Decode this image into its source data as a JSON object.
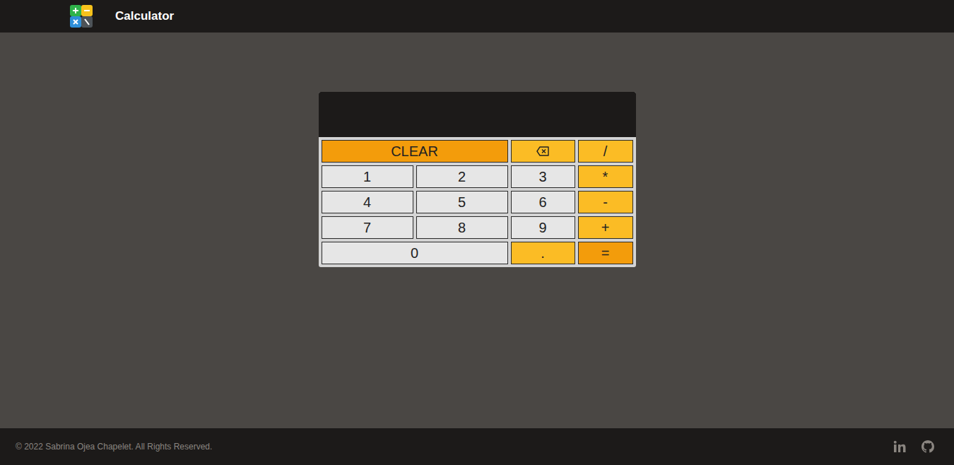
{
  "header": {
    "title": "Calculator"
  },
  "calculator": {
    "display": "",
    "keys": [
      {
        "label": "CLEAR",
        "kind": "clear"
      },
      {
        "label": "",
        "kind": "backspace"
      },
      {
        "label": "/",
        "kind": "operator"
      },
      {
        "label": "1",
        "kind": "digit"
      },
      {
        "label": "2",
        "kind": "digit"
      },
      {
        "label": "3",
        "kind": "digit"
      },
      {
        "label": "*",
        "kind": "operator"
      },
      {
        "label": "4",
        "kind": "digit"
      },
      {
        "label": "5",
        "kind": "digit"
      },
      {
        "label": "6",
        "kind": "digit"
      },
      {
        "label": "-",
        "kind": "operator"
      },
      {
        "label": "7",
        "kind": "digit"
      },
      {
        "label": "8",
        "kind": "digit"
      },
      {
        "label": "9",
        "kind": "digit"
      },
      {
        "label": "+",
        "kind": "operator"
      },
      {
        "label": "0",
        "kind": "wide-digit"
      },
      {
        "label": ".",
        "kind": "operator"
      },
      {
        "label": "=",
        "kind": "equals"
      }
    ]
  },
  "footer": {
    "copyright": "© 2022 Sabrina Ojea Chapelet. All Rights Reserved."
  }
}
